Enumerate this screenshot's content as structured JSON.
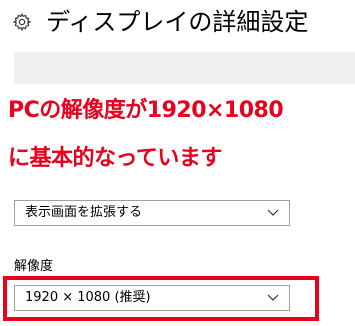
{
  "header": {
    "title": "ディスプレイの詳細設定",
    "icon": "gear-icon"
  },
  "annotation": {
    "line1": "PCの解像度が1920×1080",
    "line2": "に基本的なっています",
    "color": "#e8001c"
  },
  "display_mode": {
    "selected": "表示画面を拡張する",
    "icon": "chevron-down-icon"
  },
  "resolution": {
    "label": "解像度",
    "selected": "1920 × 1080 (推奨)",
    "icon": "chevron-down-icon"
  },
  "colors": {
    "highlight": "#e8001c",
    "border": "#a0a0a0",
    "band": "#f0f0f0"
  }
}
